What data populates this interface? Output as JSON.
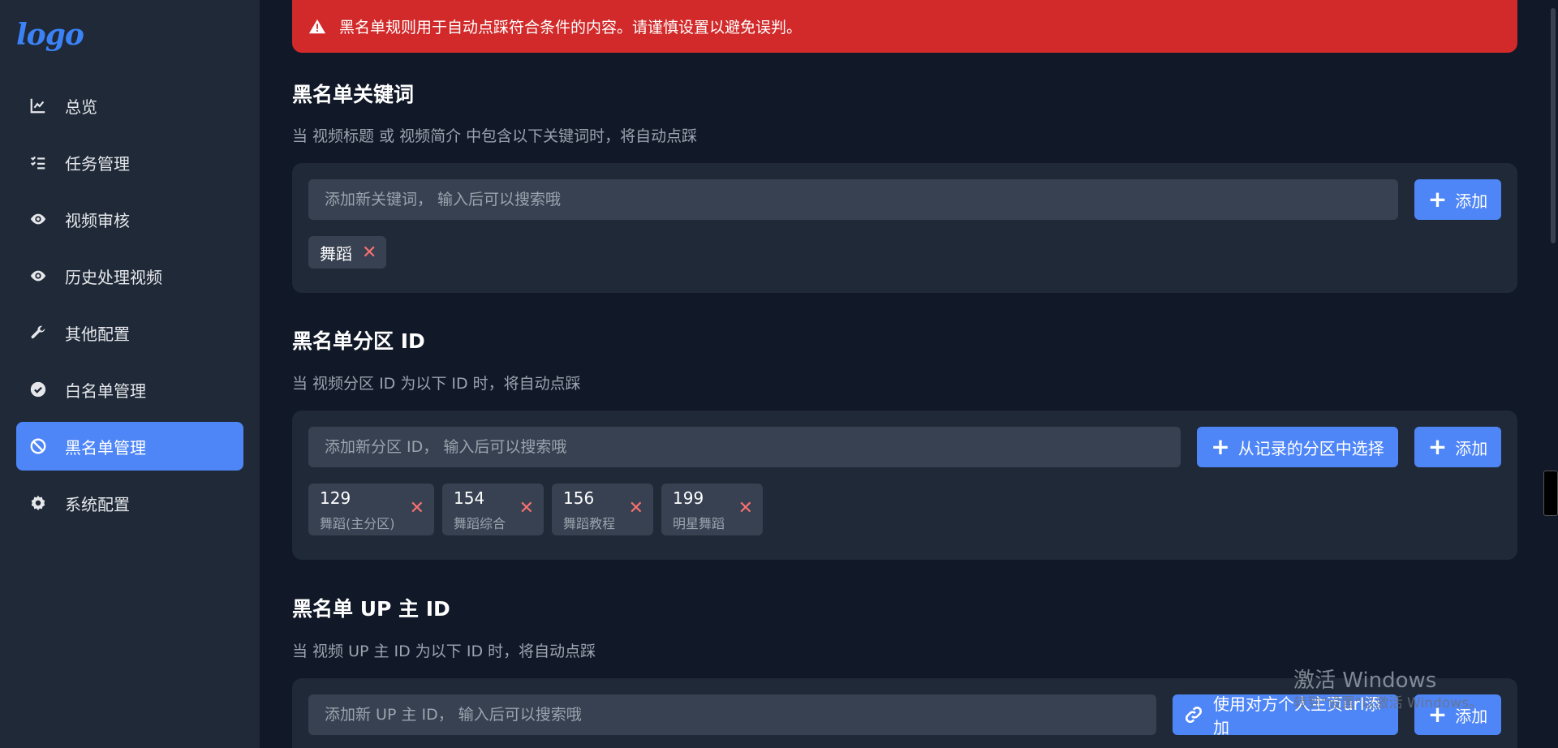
{
  "sidebar": {
    "logo": "logo",
    "items": [
      {
        "label": "总览",
        "icon": "chart-line-icon"
      },
      {
        "label": "任务管理",
        "icon": "list-check-icon"
      },
      {
        "label": "视频审核",
        "icon": "eye-icon"
      },
      {
        "label": "历史处理视频",
        "icon": "eye-icon"
      },
      {
        "label": "其他配置",
        "icon": "wrench-icon"
      },
      {
        "label": "白名单管理",
        "icon": "check-circle-icon"
      },
      {
        "label": "黑名单管理",
        "icon": "ban-icon",
        "active": true
      },
      {
        "label": "系统配置",
        "icon": "gear-icon"
      }
    ]
  },
  "alert": {
    "text": "黑名单规则用于自动点踩符合条件的内容。请谨慎设置以避免误判。",
    "color": "#d22a2a"
  },
  "keywords": {
    "title": "黑名单关键词",
    "desc": "当 视频标题 或 视频简介 中包含以下关键词时，将自动点踩",
    "placeholder": "添加新关键词， 输入后可以搜索哦",
    "add_label": "添加",
    "tags": [
      "舞蹈"
    ]
  },
  "partitions": {
    "title": "黑名单分区 ID",
    "desc": "当 视频分区 ID 为以下 ID 时，将自动点踩",
    "placeholder": "添加新分区 ID， 输入后可以搜索哦",
    "choose_label": "从记录的分区中选择",
    "add_label": "添加",
    "tags": [
      {
        "id": "129",
        "name": "舞蹈(主分区)"
      },
      {
        "id": "154",
        "name": "舞蹈综合"
      },
      {
        "id": "156",
        "name": "舞蹈教程"
      },
      {
        "id": "199",
        "name": "明星舞蹈"
      }
    ]
  },
  "uploaders": {
    "title": "黑名单 UP 主 ID",
    "desc": "当 视频 UP 主 ID 为以下 ID 时，将自动点踩",
    "placeholder": "添加新 UP 主 ID， 输入后可以搜索哦",
    "url_label": "使用对方个人主页url添加",
    "add_label": "添加"
  },
  "watermark": {
    "line1": "激活 Windows",
    "line2": "转到\"设置\"以激活 Windows。"
  },
  "colors": {
    "accent": "#4f86f7",
    "bg": "#111827",
    "panel": "#1f2937",
    "danger": "#d22a2a"
  }
}
